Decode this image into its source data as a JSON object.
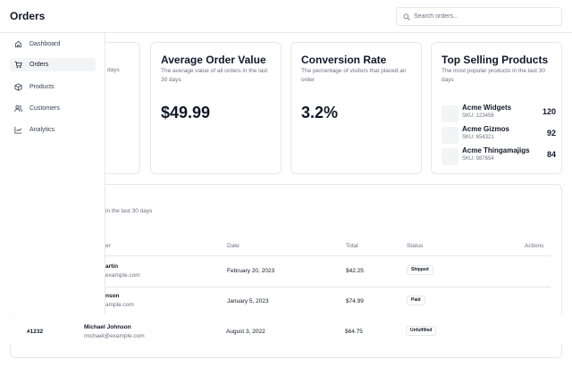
{
  "header": {
    "title": "Orders",
    "search_placeholder": "Search orders..."
  },
  "sidebar": {
    "items": [
      {
        "label": "Dashboard",
        "icon": "home-icon",
        "active": false
      },
      {
        "label": "Orders",
        "icon": "cart-icon",
        "active": true
      },
      {
        "label": "Products",
        "icon": "package-icon",
        "active": false
      },
      {
        "label": "Customers",
        "icon": "users-icon",
        "active": false
      },
      {
        "label": "Analytics",
        "icon": "chart-icon",
        "active": false
      }
    ]
  },
  "cards": {
    "total_orders": {
      "desc_partial": "days"
    },
    "avg_order": {
      "title": "Average Order Value",
      "desc": "The average value of all orders in the last 30 days",
      "value": "$49.99"
    },
    "conversion": {
      "title": "Conversion Rate",
      "desc": "The percentage of visitors that placed an order",
      "value": "3.2%"
    },
    "top_products": {
      "title": "Top Selling Products",
      "desc": "The most popular products in the last 30 days",
      "items": [
        {
          "name": "Acme Widgets",
          "sku": "SKU: 123456",
          "count": "120"
        },
        {
          "name": "Acme Gizmos",
          "sku": "SKU: 654321",
          "count": "92"
        },
        {
          "name": "Acme Thingamajigs",
          "sku": "SKU: 987654",
          "count": "84"
        }
      ]
    }
  },
  "orders": {
    "desc_partial": "in the last 30 days",
    "columns": {
      "customer_partial": "er",
      "date": "Date",
      "total": "Total",
      "status": "Status",
      "actions": "Actions"
    },
    "rows": [
      {
        "name": "artin",
        "email": "example.com",
        "date": "February 20, 2023",
        "total": "$42.25",
        "status": "Shipped"
      },
      {
        "name": "nson",
        "email": "ample.com",
        "date": "January 5, 2023",
        "total": "$74.99",
        "status": "Paid"
      }
    ],
    "last_row": {
      "id": "#1232",
      "name": "Michael Johnson",
      "email": "michael@example.com",
      "date": "August 3, 2022",
      "total": "$64.75",
      "status": "Unfulfilled"
    }
  },
  "colors": {
    "border": "#e5e7eb",
    "text": "#111827",
    "muted": "#6b7280",
    "active_bg": "#f3f4f6"
  }
}
